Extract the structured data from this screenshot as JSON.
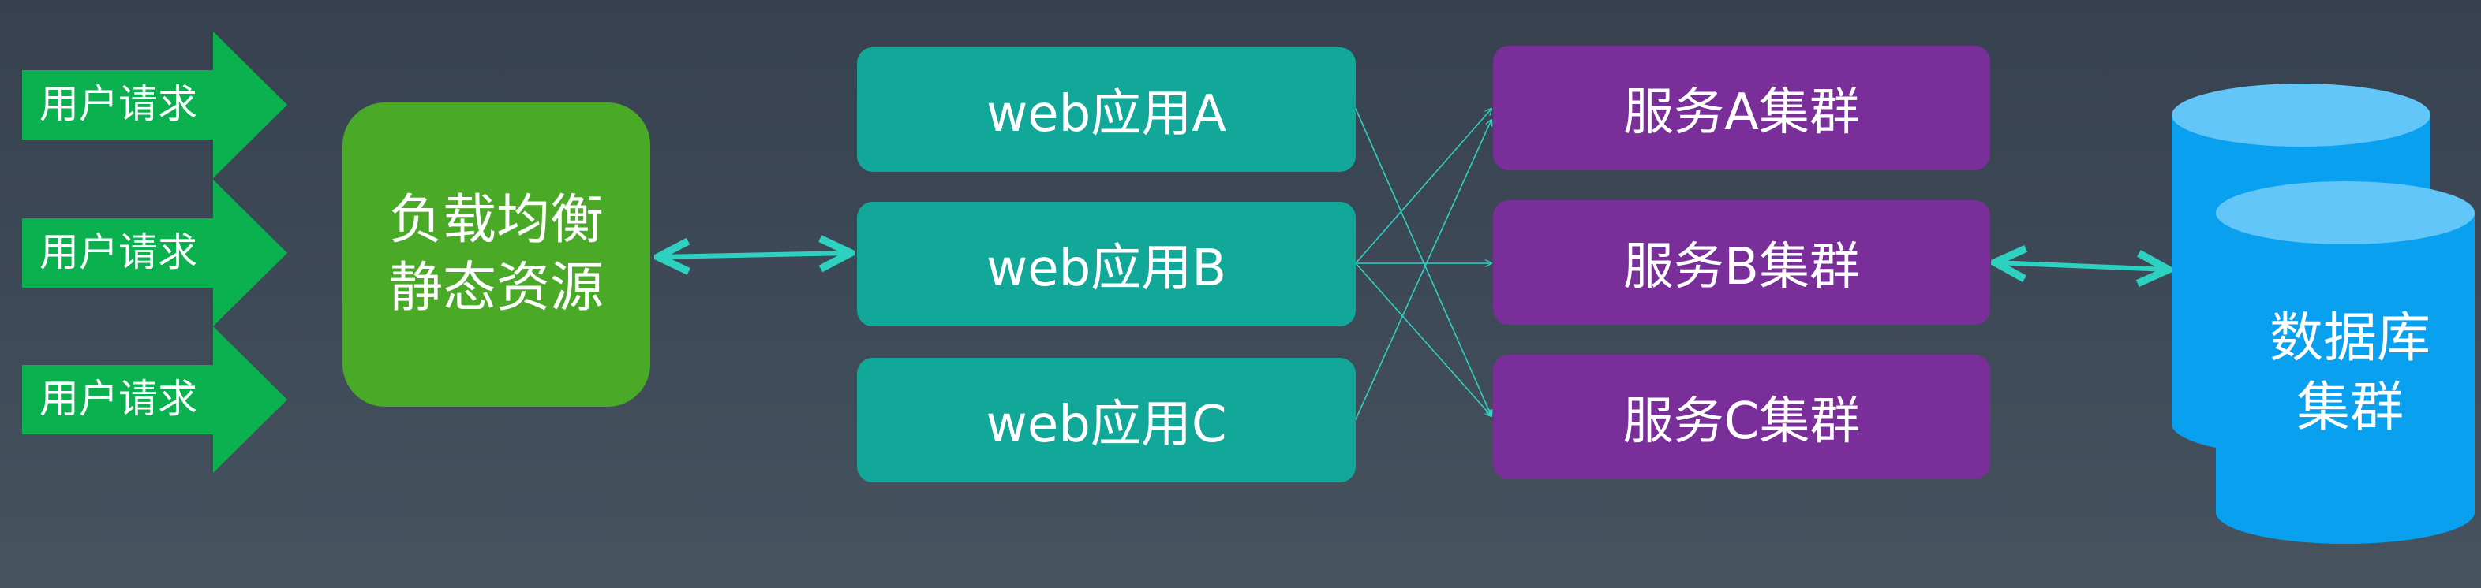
{
  "requests": [
    "用户请求",
    "用户请求",
    "用户请求"
  ],
  "load_balancer": {
    "line1": "负载均衡",
    "line2": "静态资源"
  },
  "web_apps": [
    "web应用A",
    "web应用B",
    "web应用C"
  ],
  "services": [
    "服务A集群",
    "服务B集群",
    "服务C集群"
  ],
  "database": {
    "line1": "数据库",
    "line2": "集群"
  },
  "colors": {
    "background": "#3b4553",
    "request_arrow": "#0bb14f",
    "load_balancer": "#4aaa28",
    "web_app": "#12a899",
    "service": "#7a2e9a",
    "database": "#0aa0f0",
    "connector": "#2ed1c0"
  }
}
